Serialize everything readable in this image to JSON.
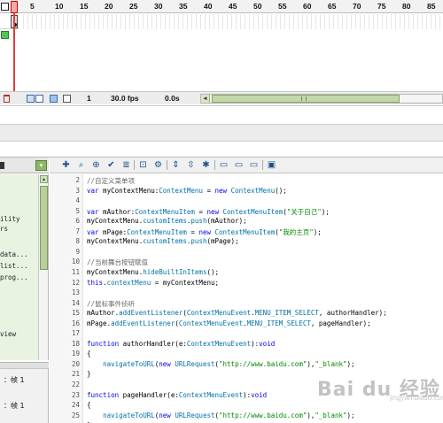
{
  "timeline": {
    "frame_numbers": [
      "5",
      "10",
      "15",
      "20",
      "25",
      "30",
      "35",
      "40",
      "45",
      "50",
      "55",
      "60",
      "65",
      "70",
      "75",
      "80",
      "85"
    ],
    "current_frame": "1",
    "fps": "30.0 fps",
    "elapsed": "0.0s"
  },
  "toolbox": {
    "items": [
      "ility",
      "rs",
      "data...",
      "list...",
      "prog...",
      "view"
    ]
  },
  "script_nav": {
    "items": [
      "：帧 1",
      "：帧 1"
    ]
  },
  "editor": {
    "toolbar_icons": [
      "add-statement-icon",
      "find-icon",
      "insert-target-path-icon",
      "check-syntax-icon",
      "auto-format-icon",
      "show-code-hint-icon",
      "debug-options-icon",
      "collapse-between-braces-icon",
      "collapse-selection-icon",
      "expand-all-icon",
      "apply-block-comment-icon",
      "apply-line-comment-icon",
      "remove-comment-icon",
      "show-hide-toolbox-icon"
    ],
    "line_numbers": [
      "2",
      "3",
      "4",
      "5",
      "6",
      "7",
      "8",
      "9",
      "10",
      "11",
      "12",
      "13",
      "14",
      "15",
      "16",
      "17",
      "18",
      "19",
      "20",
      "21",
      "22",
      "23",
      "24",
      "25"
    ],
    "lines": [
      [
        {
          "t": "//自定义菜单项",
          "c": "cm"
        }
      ],
      [
        {
          "t": "var",
          "c": "kw"
        },
        {
          "t": " myContextMenu:",
          "c": "pl"
        },
        {
          "t": "ContextMenu",
          "c": "ty"
        },
        {
          "t": " = ",
          "c": "pl"
        },
        {
          "t": "new",
          "c": "kw"
        },
        {
          "t": " ",
          "c": "pl"
        },
        {
          "t": "ContextMenu",
          "c": "ty"
        },
        {
          "t": "();",
          "c": "pl"
        }
      ],
      [],
      [
        {
          "t": "var",
          "c": "kw"
        },
        {
          "t": " mAuthor:",
          "c": "pl"
        },
        {
          "t": "ContextMenuItem",
          "c": "ty"
        },
        {
          "t": " = ",
          "c": "pl"
        },
        {
          "t": "new",
          "c": "kw"
        },
        {
          "t": " ",
          "c": "pl"
        },
        {
          "t": "ContextMenuItem",
          "c": "ty"
        },
        {
          "t": "(",
          "c": "pl"
        },
        {
          "t": "\"关于自己\"",
          "c": "st"
        },
        {
          "t": ");",
          "c": "pl"
        }
      ],
      [
        {
          "t": "myContextMenu.",
          "c": "pl"
        },
        {
          "t": "customItems",
          "c": "ty"
        },
        {
          "t": ".",
          "c": "pl"
        },
        {
          "t": "push",
          "c": "ty"
        },
        {
          "t": "(mAuthor);",
          "c": "pl"
        }
      ],
      [
        {
          "t": "var",
          "c": "kw"
        },
        {
          "t": " mPage:",
          "c": "pl"
        },
        {
          "t": "ContextMenuItem",
          "c": "ty"
        },
        {
          "t": " = ",
          "c": "pl"
        },
        {
          "t": "new",
          "c": "kw"
        },
        {
          "t": " ",
          "c": "pl"
        },
        {
          "t": "ContextMenuItem",
          "c": "ty"
        },
        {
          "t": "(",
          "c": "pl"
        },
        {
          "t": "\"我的主页\"",
          "c": "st"
        },
        {
          "t": ");",
          "c": "pl"
        }
      ],
      [
        {
          "t": "myContextMenu.",
          "c": "pl"
        },
        {
          "t": "customItems",
          "c": "ty"
        },
        {
          "t": ".",
          "c": "pl"
        },
        {
          "t": "push",
          "c": "ty"
        },
        {
          "t": "(mPage);",
          "c": "pl"
        }
      ],
      [],
      [
        {
          "t": "//当前舞台按钮赋值",
          "c": "cm"
        }
      ],
      [
        {
          "t": "myContextMenu.",
          "c": "pl"
        },
        {
          "t": "hideBuiltInItems",
          "c": "ty"
        },
        {
          "t": "();",
          "c": "pl"
        }
      ],
      [
        {
          "t": "this",
          "c": "kw"
        },
        {
          "t": ".",
          "c": "pl"
        },
        {
          "t": "contextMenu",
          "c": "ty"
        },
        {
          "t": " = myContextMenu;",
          "c": "pl"
        }
      ],
      [],
      [
        {
          "t": "//鼠标事件侦听",
          "c": "cm"
        }
      ],
      [
        {
          "t": "mAuthor.",
          "c": "pl"
        },
        {
          "t": "addEventListener",
          "c": "ty"
        },
        {
          "t": "(",
          "c": "pl"
        },
        {
          "t": "ContextMenuEvent",
          "c": "ty"
        },
        {
          "t": ".",
          "c": "pl"
        },
        {
          "t": "MENU_ITEM_SELECT",
          "c": "ty"
        },
        {
          "t": ", authorHandler);",
          "c": "pl"
        }
      ],
      [
        {
          "t": "mPage.",
          "c": "pl"
        },
        {
          "t": "addEventListener",
          "c": "ty"
        },
        {
          "t": "(",
          "c": "pl"
        },
        {
          "t": "ContextMenuEvent",
          "c": "ty"
        },
        {
          "t": ".",
          "c": "pl"
        },
        {
          "t": "MENU_ITEM_SELECT",
          "c": "ty"
        },
        {
          "t": ", pageHandler);",
          "c": "pl"
        }
      ],
      [],
      [
        {
          "t": "function",
          "c": "kw"
        },
        {
          "t": " authorHandler(e:",
          "c": "pl"
        },
        {
          "t": "ContextMenuEvent",
          "c": "ty"
        },
        {
          "t": "):",
          "c": "pl"
        },
        {
          "t": "void",
          "c": "kw"
        }
      ],
      [
        {
          "t": "{",
          "c": "pl"
        }
      ],
      [
        {
          "t": "    ",
          "c": "pl"
        },
        {
          "t": "navigateToURL",
          "c": "ty"
        },
        {
          "t": "(",
          "c": "pl"
        },
        {
          "t": "new",
          "c": "kw"
        },
        {
          "t": " ",
          "c": "pl"
        },
        {
          "t": "URLRequest",
          "c": "ty"
        },
        {
          "t": "(",
          "c": "pl"
        },
        {
          "t": "\"http://www.baidu.com\"",
          "c": "st"
        },
        {
          "t": "),",
          "c": "pl"
        },
        {
          "t": "\"_blank\"",
          "c": "st"
        },
        {
          "t": ");",
          "c": "pl"
        }
      ],
      [
        {
          "t": "}",
          "c": "pl"
        }
      ],
      [],
      [
        {
          "t": "function",
          "c": "kw"
        },
        {
          "t": " pageHandler(e:",
          "c": "pl"
        },
        {
          "t": "ContextMenuEvent",
          "c": "ty"
        },
        {
          "t": "):",
          "c": "pl"
        },
        {
          "t": "void",
          "c": "kw"
        }
      ],
      [
        {
          "t": "{",
          "c": "pl"
        }
      ],
      [
        {
          "t": "    ",
          "c": "pl"
        },
        {
          "t": "navigateToURL",
          "c": "ty"
        },
        {
          "t": "(",
          "c": "pl"
        },
        {
          "t": "new",
          "c": "kw"
        },
        {
          "t": " ",
          "c": "pl"
        },
        {
          "t": "URLRequest",
          "c": "ty"
        },
        {
          "t": "(",
          "c": "pl"
        },
        {
          "t": "\"http://www.baidu.com\"",
          "c": "st"
        },
        {
          "t": "),",
          "c": "pl"
        },
        {
          "t": "\"_blank\"",
          "c": "st"
        },
        {
          "t": ");",
          "c": "pl"
        }
      ],
      [
        {
          "t": "}",
          "c": "pl"
        }
      ]
    ]
  },
  "watermark": {
    "logo": "Bai du 经验",
    "sub": "jingyan.baidu.com"
  },
  "colors": {
    "comment": "#666666",
    "keyword": "#0000ff",
    "type": "#0070a8",
    "string": "#008800",
    "playhead": "#e23a3a",
    "toolbox_bg": "#e9f3e2"
  }
}
